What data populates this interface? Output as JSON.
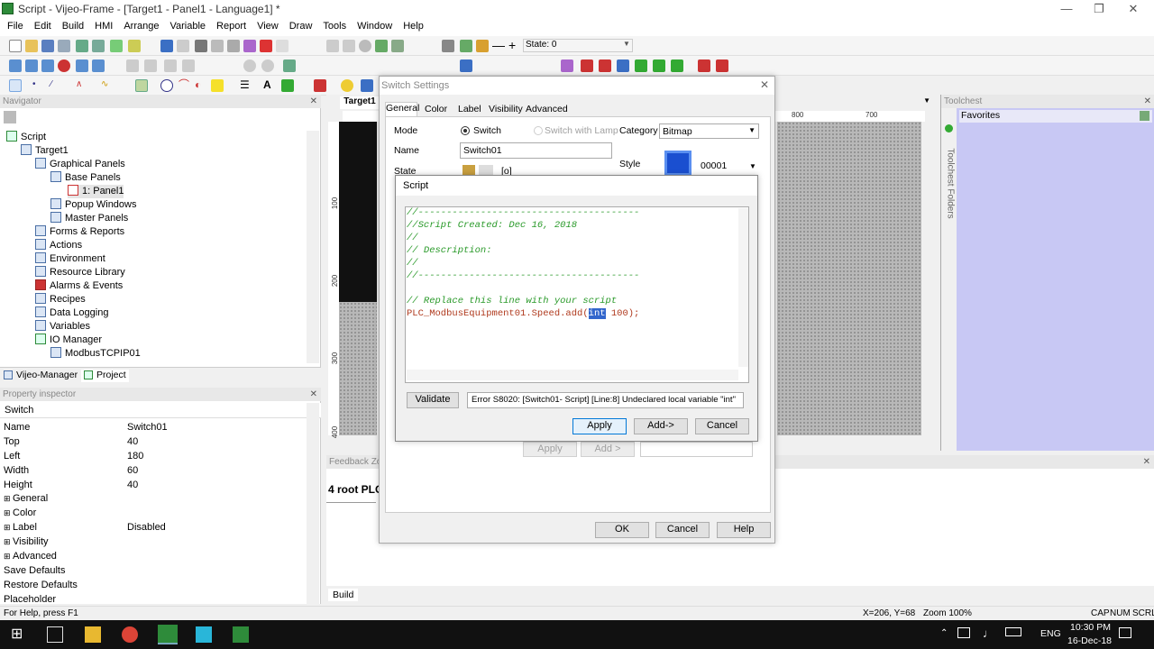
{
  "window": {
    "title": "Script - Vijeo-Frame - [Target1 - Panel1 - Language1] *"
  },
  "menu": [
    "File",
    "Edit",
    "Build",
    "HMI",
    "Arrange",
    "Variable",
    "Report",
    "View",
    "Draw",
    "Tools",
    "Window",
    "Help"
  ],
  "toolbar": {
    "state_label": "State: 0"
  },
  "navigator": {
    "title": "Navigator",
    "items": [
      {
        "label": "Script"
      },
      {
        "label": "Target1"
      },
      {
        "label": "Graphical Panels"
      },
      {
        "label": "Base Panels"
      },
      {
        "label": "1: Panel1"
      },
      {
        "label": "Popup Windows"
      },
      {
        "label": "Master Panels"
      },
      {
        "label": "Forms & Reports"
      },
      {
        "label": "Actions"
      },
      {
        "label": "Environment"
      },
      {
        "label": "Resource Library"
      },
      {
        "label": "Alarms & Events"
      },
      {
        "label": "Recipes"
      },
      {
        "label": "Data Logging"
      },
      {
        "label": "Variables"
      },
      {
        "label": "IO Manager"
      },
      {
        "label": "ModbusTCPIP01"
      }
    ],
    "tabs": [
      "Vijeo-Manager",
      "Project"
    ]
  },
  "property_inspector": {
    "title": "Property inspector",
    "object": "Switch",
    "rows": [
      {
        "k": "Name",
        "v": "Switch01"
      },
      {
        "k": "Top",
        "v": "40"
      },
      {
        "k": "Left",
        "v": "180"
      },
      {
        "k": "Width",
        "v": "60"
      },
      {
        "k": "Height",
        "v": "40"
      },
      {
        "k": "General",
        "v": ""
      },
      {
        "k": "Color",
        "v": ""
      },
      {
        "k": "Label",
        "v": "Disabled"
      },
      {
        "k": "Visibility",
        "v": ""
      },
      {
        "k": "Advanced",
        "v": ""
      },
      {
        "k": "Save Defaults",
        "v": ""
      },
      {
        "k": "Restore Defaults",
        "v": ""
      },
      {
        "k": "Placeholder",
        "v": ""
      }
    ]
  },
  "editor": {
    "tab": "Target1",
    "ruler_top": [
      "800",
      "700"
    ],
    "ruler_left": [
      "100",
      "200",
      "300",
      "400"
    ]
  },
  "switch_settings": {
    "title": "Switch Settings",
    "tabs": [
      "General",
      "Color",
      "Label",
      "Visibility",
      "Advanced"
    ],
    "mode_label": "Mode",
    "mode_switch": "Switch",
    "mode_lamp": "Switch with Lamp",
    "category_label": "Category",
    "category_value": "Bitmap",
    "name_label": "Name",
    "name_value": "Switch01",
    "style_label": "Style",
    "style_value": "00001",
    "state_label": "State",
    "state_value": "[o]",
    "apply": "Apply",
    "add": "Add >",
    "ok": "OK",
    "cancel": "Cancel",
    "help": "Help"
  },
  "script_dialog": {
    "title": "Script",
    "lines": [
      "//---------------------------------------",
      "//Script Created: Dec 16, 2018",
      "//",
      "// Description:",
      "//",
      "//---------------------------------------",
      "",
      "// Replace this line with your script"
    ],
    "code_pre": "PLC_ModbusEquipment01.Speed.add(",
    "code_sel": "int",
    "code_post": " 100);",
    "validate": "Validate",
    "error": "Error S8020: [Switch01- Script] [Line:8] Undeclared local variable \"int\"",
    "apply": "Apply",
    "add": "Add->",
    "cancel": "Cancel"
  },
  "toolchest": {
    "title": "Toolchest",
    "favorites": "Favorites",
    "side_tab": "Toolchest Folders"
  },
  "feedback": {
    "title": "Feedback Zo",
    "content": "4 root PLC"
  },
  "build_tab": "Build",
  "status": {
    "help": "For Help, press F1",
    "coords": "X=206, Y=68",
    "zoom": "Zoom 100%",
    "cap": "CAP",
    "num": "NUM",
    "scrl": "SCRL"
  },
  "taskbar": {
    "lang": "ENG",
    "time": "10:30 PM",
    "date": "16-Dec-18"
  }
}
